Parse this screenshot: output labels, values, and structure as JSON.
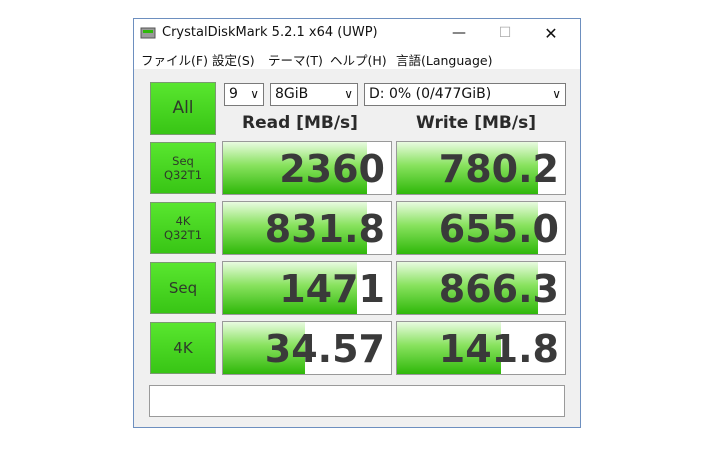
{
  "window": {
    "title": "CrystalDiskMark 5.2.1 x64 (UWP)"
  },
  "menu": [
    "ファイル(F)",
    "設定(S)",
    "テーマ(T)",
    "ヘルプ(H)",
    "言語(Language)"
  ],
  "controls": {
    "all_label": "All",
    "count": "9",
    "size": "8GiB",
    "drive": "D: 0% (0/477GiB)"
  },
  "headers": {
    "read": "Read [MB/s]",
    "write": "Write [MB/s]"
  },
  "tests": [
    {
      "label": "Seq\nQ32T1",
      "read": "2360",
      "write": "780.2"
    },
    {
      "label": "4K\nQ32T1",
      "read": "831.8",
      "write": "655.0"
    },
    {
      "label": "Seq",
      "read": "1471",
      "write": "866.3"
    },
    {
      "label": "4K",
      "read": "34.57",
      "write": "141.8"
    }
  ],
  "comment": "",
  "colors": {
    "accent_green": "#3ec81a",
    "window_border": "#6d8fbf"
  }
}
